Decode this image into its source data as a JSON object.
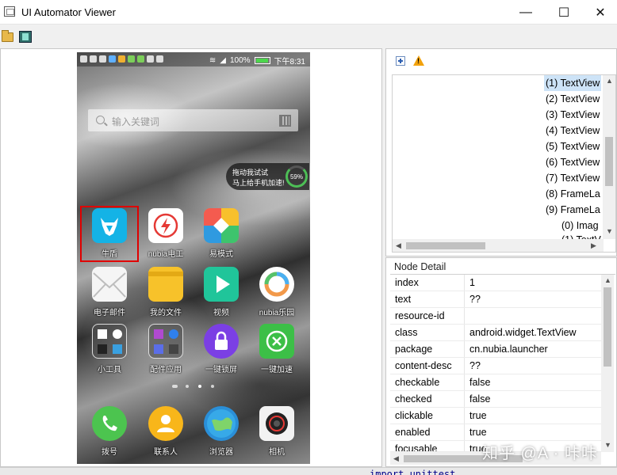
{
  "window": {
    "title": "UI Automator Viewer",
    "controls": {
      "minimize": "—",
      "maximize": "☐",
      "close": "✕"
    }
  },
  "device": {
    "status_bar": {
      "battery": "100%",
      "time": "下午8:31"
    },
    "search": {
      "placeholder": "输入关键词"
    },
    "boost_widget": {
      "line1": "拖动我试试",
      "line2": "马上给手机加速!",
      "percent": "59%"
    },
    "apps": [
      {
        "label": "牛盾",
        "color": "#14b3e6",
        "icon": "bull-shield-icon"
      },
      {
        "label": "nubia电工",
        "color": "#ffffff",
        "icon": "lightning-icon"
      },
      {
        "label": "易模式",
        "color": "#f3a33a",
        "icon": "four-color-icon"
      },
      {
        "label": "电子邮件",
        "color": "#f5f5f5",
        "icon": "mail-icon"
      },
      {
        "label": "我的文件",
        "color": "#f7c22a",
        "icon": "folder-icon"
      },
      {
        "label": "视频",
        "color": "#20c59a",
        "icon": "play-icon"
      },
      {
        "label": "nubia乐园",
        "color": "#ffffff",
        "icon": "ring-icon"
      },
      {
        "label": "小工具",
        "color": "#6d6d6d",
        "icon": "widgets-folder-icon"
      },
      {
        "label": "配件应用",
        "color": "#6d6d6d",
        "icon": "accessories-folder-icon"
      },
      {
        "label": "一键锁屏",
        "color": "#7b3fe4",
        "icon": "lock-icon"
      },
      {
        "label": "一键加速",
        "color": "#3cbf47",
        "icon": "speedup-icon"
      }
    ],
    "dock": [
      {
        "label": "拨号",
        "color": "#4cc44f",
        "icon": "phone-icon"
      },
      {
        "label": "联系人",
        "color": "#f8b61a",
        "icon": "contact-icon"
      },
      {
        "label": "浏览器",
        "color": "#2a8fd8",
        "icon": "globe-icon"
      },
      {
        "label": "相机",
        "color": "#f2f2f2",
        "icon": "camera-icon"
      }
    ]
  },
  "hierarchy": {
    "rows": [
      {
        "label": "(1) TextView",
        "selected": true
      },
      {
        "label": "(2) TextView",
        "selected": false
      },
      {
        "label": "(3) TextView",
        "selected": false
      },
      {
        "label": "(4) TextView",
        "selected": false
      },
      {
        "label": "(5) TextView",
        "selected": false
      },
      {
        "label": "(6) TextView",
        "selected": false
      },
      {
        "label": "(7) TextView",
        "selected": false
      },
      {
        "label": "(8) FrameLa",
        "selected": false
      },
      {
        "label": "(9) FrameLa",
        "selected": false
      },
      {
        "label": "(0) Imag",
        "selected": false
      },
      {
        "label": "(1) TextV",
        "selected": false
      }
    ]
  },
  "node_detail": {
    "title": "Node Detail",
    "rows": [
      {
        "key": "index",
        "value": "1"
      },
      {
        "key": "text",
        "value": "??"
      },
      {
        "key": "resource-id",
        "value": ""
      },
      {
        "key": "class",
        "value": "android.widget.TextView"
      },
      {
        "key": "package",
        "value": "cn.nubia.launcher"
      },
      {
        "key": "content-desc",
        "value": "??"
      },
      {
        "key": "checkable",
        "value": "false"
      },
      {
        "key": "checked",
        "value": "false"
      },
      {
        "key": "clickable",
        "value": "true"
      },
      {
        "key": "enabled",
        "value": "true"
      },
      {
        "key": "focusable",
        "value": "true"
      }
    ]
  },
  "watermark": "知乎 @A · 咔咔",
  "bottom_code": "import unittest"
}
